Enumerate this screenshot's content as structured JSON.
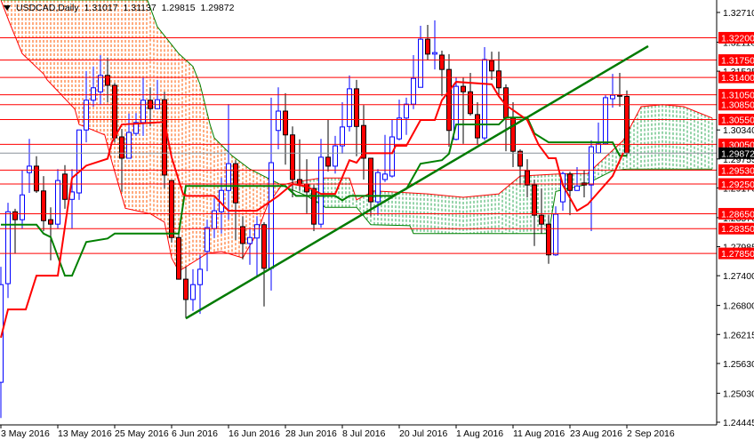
{
  "header": {
    "symbol": "USDCAD,Daily",
    "open": "1.31017",
    "high": "1.31137",
    "low": "1.29815",
    "close": "1.29872"
  },
  "colors": {
    "bull": "#0000ff",
    "bear": "#ff0000",
    "tenkan": "#ff0000",
    "kijun": "#008000",
    "trendline": "#007a00",
    "cloud_bear": "#ff5a00",
    "cloud_bull": "#2eaa55",
    "level": "#ff0000",
    "current_price": "#000000"
  },
  "chart_data": {
    "type": "candlestick",
    "title": "USDCAD,Daily",
    "ylim": [
      1.2439,
      1.3296
    ],
    "y_ticks": [
      "1.32710",
      "1.32110",
      "1.31525",
      "1.30340",
      "1.29755",
      "1.29170",
      "1.28570",
      "1.27985",
      "1.27400",
      "1.26800",
      "1.26215",
      "1.25630",
      "1.25030",
      "1.24445"
    ],
    "x_labels": [
      {
        "bar": 0,
        "label": "3 May 2016"
      },
      {
        "bar": 8,
        "label": "13 May 2016"
      },
      {
        "bar": 16,
        "label": "25 May 2016"
      },
      {
        "bar": 24,
        "label": "6 Jun 2016"
      },
      {
        "bar": 32,
        "label": "16 Jun 2016"
      },
      {
        "bar": 40,
        "label": "28 Jun 2016"
      },
      {
        "bar": 48,
        "label": "8 Jul 2016"
      },
      {
        "bar": 56,
        "label": "20 Jul 2016"
      },
      {
        "bar": 64,
        "label": "1 Aug 2016"
      },
      {
        "bar": 72,
        "label": "11 Aug 2016"
      },
      {
        "bar": 80,
        "label": "23 Aug 2016"
      },
      {
        "bar": 88,
        "label": "2 Sep 2016"
      }
    ],
    "ohlc": [
      [
        1.2525,
        1.2758,
        1.2453,
        1.2722
      ],
      [
        1.2724,
        1.2887,
        1.2695,
        1.2869
      ],
      [
        1.2869,
        1.2875,
        1.2785,
        1.2853
      ],
      [
        1.2853,
        1.2952,
        1.2835,
        1.2903
      ],
      [
        1.2948,
        1.3016,
        1.2907,
        1.2961
      ],
      [
        1.2961,
        1.2981,
        1.2907,
        1.2911
      ],
      [
        1.2911,
        1.2941,
        1.283,
        1.2851
      ],
      [
        1.2853,
        1.2878,
        1.2771,
        1.2844
      ],
      [
        1.2844,
        1.2955,
        1.2835,
        1.2932
      ],
      [
        1.2945,
        1.2963,
        1.2875,
        1.2894
      ],
      [
        1.2894,
        1.2955,
        1.2835,
        1.2909
      ],
      [
        1.2907,
        1.3034,
        1.2893,
        1.3034
      ],
      [
        1.3034,
        1.3153,
        1.3009,
        1.3094
      ],
      [
        1.3094,
        1.3162,
        1.3081,
        1.3119
      ],
      [
        1.3111,
        1.3185,
        1.3084,
        1.3144
      ],
      [
        1.3144,
        1.318,
        1.309,
        1.3124
      ],
      [
        1.3124,
        1.3129,
        1.3009,
        1.3018
      ],
      [
        1.302,
        1.3036,
        1.2909,
        1.2977
      ],
      [
        1.2977,
        1.3067,
        1.2977,
        1.3029
      ],
      [
        1.3027,
        1.3068,
        1.3022,
        1.3049
      ],
      [
        1.3049,
        1.314,
        1.3022,
        1.3094
      ],
      [
        1.3094,
        1.312,
        1.3041,
        1.3077
      ],
      [
        1.3077,
        1.3135,
        1.3076,
        1.3095
      ],
      [
        1.3095,
        1.3111,
        1.2916,
        1.2943
      ],
      [
        1.2932,
        1.2932,
        1.2807,
        1.2817
      ],
      [
        1.2817,
        1.283,
        1.2732,
        1.2733
      ],
      [
        1.2733,
        1.2758,
        1.2654,
        1.2692
      ],
      [
        1.2692,
        1.2753,
        1.2669,
        1.2722
      ],
      [
        1.2722,
        1.2782,
        1.2663,
        1.2753
      ],
      [
        1.2789,
        1.2853,
        1.2749,
        1.2837
      ],
      [
        1.2835,
        1.2896,
        1.2816,
        1.2871
      ],
      [
        1.2869,
        1.2938,
        1.2825,
        1.2912
      ],
      [
        1.2912,
        1.3086,
        1.2853,
        1.2966
      ],
      [
        1.2966,
        1.2973,
        1.2812,
        1.2887
      ],
      [
        1.2839,
        1.286,
        1.2773,
        1.2805
      ],
      [
        1.2805,
        1.2834,
        1.2762,
        1.2817
      ],
      [
        1.2816,
        1.286,
        1.274,
        1.2843
      ],
      [
        1.2843,
        1.2848,
        1.2678,
        1.2755
      ],
      [
        1.2755,
        1.3099,
        1.271,
        1.2968
      ],
      [
        1.3033,
        1.312,
        1.2995,
        1.3072
      ],
      [
        1.3072,
        1.3108,
        1.2964,
        1.3024
      ],
      [
        1.3024,
        1.3041,
        1.2898,
        1.2934
      ],
      [
        1.2934,
        1.3015,
        1.2912,
        1.2925
      ],
      [
        1.2925,
        1.2975,
        1.2866,
        1.2909
      ],
      [
        1.2916,
        1.2923,
        1.283,
        1.2844
      ],
      [
        1.2844,
        1.3016,
        1.2837,
        1.2979
      ],
      [
        1.2979,
        1.3054,
        1.295,
        1.2961
      ],
      [
        1.2961,
        1.3022,
        1.2946,
        1.3002
      ],
      [
        1.3002,
        1.309,
        1.2986,
        1.304
      ],
      [
        1.3041,
        1.3144,
        1.3031,
        1.3117
      ],
      [
        1.3117,
        1.3135,
        1.2981,
        1.3041
      ],
      [
        1.3043,
        1.3084,
        1.2934,
        1.2977
      ],
      [
        1.2977,
        1.2977,
        1.286,
        1.2889
      ],
      [
        1.2889,
        1.2955,
        1.2862,
        1.2948
      ],
      [
        1.2934,
        1.3024,
        1.2929,
        1.2945
      ],
      [
        1.2941,
        1.3054,
        1.2938,
        1.302
      ],
      [
        1.3016,
        1.3095,
        1.3013,
        1.3058
      ],
      [
        1.3058,
        1.3099,
        1.3024,
        1.3086
      ],
      [
        1.3086,
        1.3185,
        1.3076,
        1.3138
      ],
      [
        1.312,
        1.3244,
        1.312,
        1.3217
      ],
      [
        1.3217,
        1.3246,
        1.3176,
        1.3187
      ],
      [
        1.3187,
        1.3255,
        1.3156,
        1.319
      ],
      [
        1.3185,
        1.3194,
        1.3102,
        1.3156
      ],
      [
        1.3156,
        1.3187,
        1.3,
        1.3033
      ],
      [
        1.3015,
        1.314,
        1.3013,
        1.3122
      ],
      [
        1.3122,
        1.314,
        1.3006,
        1.3111
      ],
      [
        1.3111,
        1.3149,
        1.3063,
        1.3067
      ],
      [
        1.3065,
        1.309,
        1.3004,
        1.3018
      ],
      [
        1.3018,
        1.3201,
        1.3013,
        1.3176
      ],
      [
        1.3174,
        1.3192,
        1.3135,
        1.3153
      ],
      [
        1.3153,
        1.3192,
        1.3104,
        1.3119
      ],
      [
        1.3119,
        1.3126,
        1.2991,
        1.3058
      ],
      [
        1.3058,
        1.309,
        1.2959,
        1.2991
      ],
      [
        1.2991,
        1.2995,
        1.2923,
        1.2961
      ],
      [
        1.2952,
        1.2975,
        1.2898,
        1.2923
      ],
      [
        1.2923,
        1.2934,
        1.28,
        1.2862
      ],
      [
        1.2862,
        1.2916,
        1.2825,
        1.2844
      ],
      [
        1.2844,
        1.2862,
        1.2764,
        1.2782
      ],
      [
        1.2782,
        1.288,
        1.278,
        1.2864
      ],
      [
        1.2889,
        1.295,
        1.2871,
        1.2946
      ],
      [
        1.2945,
        1.295,
        1.2862,
        1.2912
      ],
      [
        1.2912,
        1.2959,
        1.2911,
        1.2921
      ],
      [
        1.2927,
        1.2952,
        1.2898,
        1.2923
      ],
      [
        1.2923,
        1.3013,
        1.283,
        1.3
      ],
      [
        1.2988,
        1.3049,
        1.2986,
        1.3006
      ],
      [
        1.3006,
        1.3104,
        1.3004,
        1.3099
      ],
      [
        1.3097,
        1.3147,
        1.3079,
        1.3104
      ],
      [
        1.3104,
        1.3149,
        1.3081,
        1.3102
      ],
      [
        1.31017,
        1.31137,
        1.29815,
        1.29872
      ]
    ],
    "tenkan": [
      [
        0,
        1.2615
      ],
      [
        1,
        1.2672
      ],
      [
        3.5,
        1.2672
      ],
      [
        5,
        1.274
      ],
      [
        8,
        1.274
      ],
      [
        10,
        1.2937
      ],
      [
        12,
        1.2962
      ],
      [
        15,
        1.2976
      ],
      [
        15.6,
        1.3009
      ],
      [
        17,
        1.3045
      ],
      [
        23,
        1.305
      ],
      [
        24,
        1.2979
      ],
      [
        25.6,
        1.2905
      ],
      [
        26,
        1.2901
      ],
      [
        30,
        1.2901
      ],
      [
        32,
        1.2871
      ],
      [
        36,
        1.2871
      ],
      [
        39,
        1.2901
      ],
      [
        41,
        1.2925
      ],
      [
        43,
        1.292
      ],
      [
        45,
        1.2905
      ],
      [
        47,
        1.2905
      ],
      [
        49,
        1.2973
      ],
      [
        50,
        1.2968
      ],
      [
        51,
        1.2987
      ],
      [
        55,
        1.2987
      ],
      [
        55.5,
        1.3002
      ],
      [
        57,
        1.3002
      ],
      [
        59,
        1.3054
      ],
      [
        61,
        1.3054
      ],
      [
        62,
        1.3094
      ],
      [
        64,
        1.3131
      ],
      [
        69,
        1.3126
      ],
      [
        70,
        1.3102
      ],
      [
        71,
        1.3084
      ],
      [
        74,
        1.3054
      ],
      [
        75.6,
        1.3004
      ],
      [
        77,
        1.2977
      ],
      [
        78,
        1.2977
      ],
      [
        79,
        1.2923
      ],
      [
        81,
        1.2871
      ],
      [
        82.5,
        1.2884
      ],
      [
        86,
        1.2941
      ],
      [
        87.5,
        1.2988
      ]
    ],
    "kijun": [
      [
        0,
        1.2843
      ],
      [
        5,
        1.2843
      ],
      [
        6,
        1.2825
      ],
      [
        7,
        1.2818
      ],
      [
        9,
        1.274
      ],
      [
        10,
        1.274
      ],
      [
        12,
        1.2808
      ],
      [
        15,
        1.2815
      ],
      [
        16,
        1.2825
      ],
      [
        25,
        1.2825
      ],
      [
        26,
        1.2921
      ],
      [
        40,
        1.2921
      ],
      [
        41.5,
        1.2901
      ],
      [
        47,
        1.2901
      ],
      [
        48,
        1.2892
      ],
      [
        49,
        1.2901
      ],
      [
        55,
        1.2901
      ],
      [
        57,
        1.2915
      ],
      [
        59,
        1.2966
      ],
      [
        62,
        1.2973
      ],
      [
        63,
        1.2986
      ],
      [
        64,
        1.3045
      ],
      [
        70,
        1.3045
      ],
      [
        71,
        1.3059
      ],
      [
        74,
        1.3059
      ],
      [
        75,
        1.3027
      ],
      [
        77,
        1.3009
      ],
      [
        86,
        1.3009
      ],
      [
        87,
        1.2982
      ],
      [
        88,
        1.2982
      ]
    ],
    "span_a": [
      [
        0,
        1.3296
      ],
      [
        1.2,
        1.3251
      ],
      [
        3,
        1.3188
      ],
      [
        6,
        1.3147
      ],
      [
        6.5,
        1.3135
      ],
      [
        10.4,
        1.3076
      ],
      [
        11,
        1.3045
      ],
      [
        14.6,
        1.3024
      ],
      [
        15.6,
        1.297
      ],
      [
        17.5,
        1.2876
      ],
      [
        21,
        1.2865
      ],
      [
        23,
        1.2848
      ],
      [
        24,
        1.2776
      ],
      [
        25,
        1.2749
      ],
      [
        29,
        1.2785
      ],
      [
        31,
        1.2789
      ],
      [
        34,
        1.2776
      ],
      [
        36,
        1.2826
      ],
      [
        37.5,
        1.2883
      ],
      [
        39.5,
        1.2923
      ],
      [
        41,
        1.2928
      ],
      [
        45,
        1.2937
      ],
      [
        49,
        1.2937
      ],
      [
        50,
        1.2893
      ],
      [
        52.5,
        1.2911
      ],
      [
        60,
        1.2905
      ],
      [
        65,
        1.2898
      ],
      [
        70,
        1.2905
      ],
      [
        73,
        1.2941
      ],
      [
        78,
        1.2945
      ],
      [
        82.5,
        1.2946
      ],
      [
        87.5,
        1.3013
      ],
      [
        90,
        1.3081
      ],
      [
        93,
        1.3085
      ],
      [
        96,
        1.3081
      ],
      [
        100,
        1.3058
      ]
    ],
    "span_b": [
      [
        0,
        1.332
      ],
      [
        20.6,
        1.3296
      ],
      [
        22,
        1.3242
      ],
      [
        23,
        1.3224
      ],
      [
        25,
        1.3188
      ],
      [
        27,
        1.3162
      ],
      [
        28,
        1.3126
      ],
      [
        29.4,
        1.3045
      ],
      [
        30,
        1.3018
      ],
      [
        32.5,
        1.2982
      ],
      [
        35,
        1.2955
      ],
      [
        37.5,
        1.2937
      ],
      [
        40,
        1.2919
      ],
      [
        43,
        1.2901
      ],
      [
        45.6,
        1.2878
      ],
      [
        50,
        1.2878
      ],
      [
        52,
        1.2843
      ],
      [
        57.5,
        1.2841
      ],
      [
        58,
        1.2825
      ],
      [
        77,
        1.2825
      ],
      [
        78,
        1.291
      ],
      [
        82,
        1.2923
      ],
      [
        86,
        1.2952
      ],
      [
        88,
        1.2955
      ],
      [
        100,
        1.2955
      ]
    ],
    "trendline": [
      [
        26,
        1.2654
      ],
      [
        91,
        1.3203
      ]
    ],
    "levels": [
      "1.32200",
      "1.31750",
      "1.31400",
      "1.31050",
      "1.30850",
      "1.30550",
      "1.30050",
      "1.29530",
      "1.29250",
      "1.28650",
      "1.28350",
      "1.27850"
    ],
    "current_price": "1.29872"
  }
}
